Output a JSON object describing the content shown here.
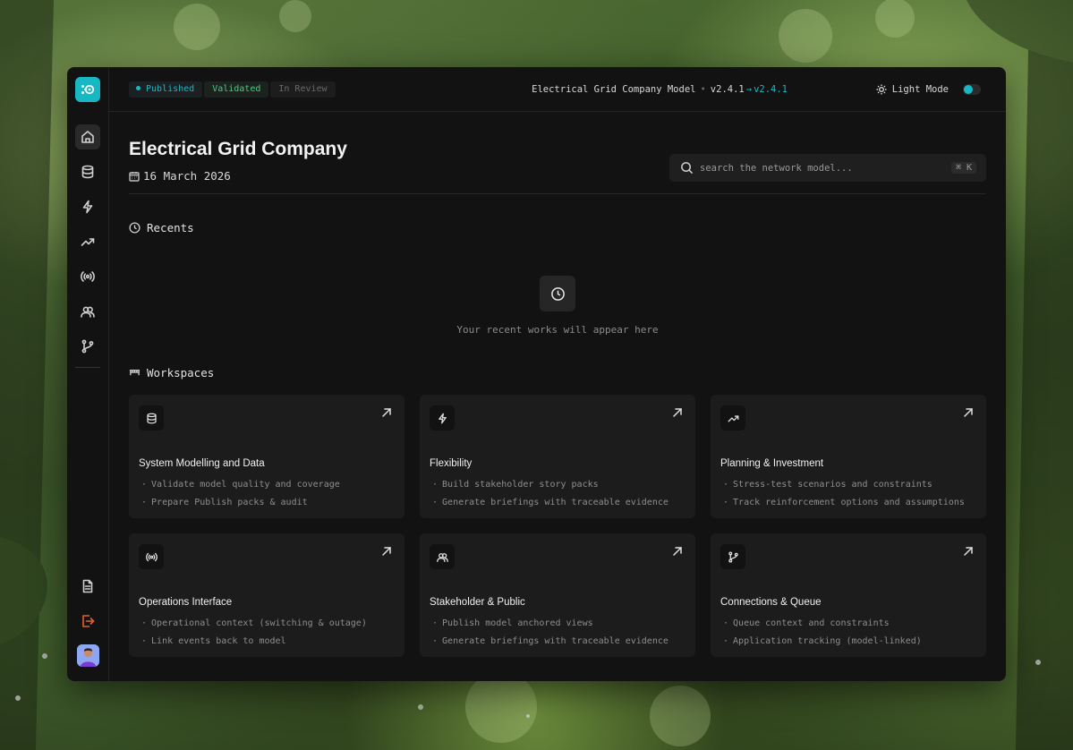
{
  "status_pills": [
    "Published",
    "Validated",
    "In Review"
  ],
  "model": {
    "name": "Electrical Grid Company Model",
    "version_from": "v2.4.1",
    "version_to": "v2.4.1"
  },
  "mode_label": "Light Mode",
  "page": {
    "title": "Electrical Grid Company",
    "date": "16 March 2026"
  },
  "search": {
    "placeholder": "search the network model...",
    "shortcut": "⌘ K"
  },
  "recents": {
    "heading": "Recents",
    "empty_text": "Your recent works will appear here"
  },
  "workspaces": {
    "heading": "Workspaces",
    "cards": [
      {
        "title": "System Modelling and Data",
        "icon": "database-icon",
        "bullets": [
          "Validate model quality and coverage",
          "Prepare Publish packs & audit"
        ]
      },
      {
        "title": "Flexibility",
        "icon": "lightning-icon",
        "bullets": [
          "Build stakeholder story packs",
          "Generate briefings with traceable evidence"
        ]
      },
      {
        "title": "Planning & Investment",
        "icon": "trending-up-icon",
        "bullets": [
          "Stress-test scenarios and constraints",
          "Track reinforcement options and assumptions"
        ]
      },
      {
        "title": "Operations Interface",
        "icon": "broadcast-icon",
        "bullets": [
          "Operational context (switching & outage)",
          "Link events back to model"
        ]
      },
      {
        "title": "Stakeholder & Public",
        "icon": "users-icon",
        "bullets": [
          "Publish model anchored views",
          "Generate briefings with traceable evidence"
        ]
      },
      {
        "title": "Connections & Queue",
        "icon": "git-branch-icon",
        "bullets": [
          "Queue context and constraints",
          "Application tracking (model-linked)"
        ]
      }
    ]
  },
  "sidebar": {
    "items": [
      "home-icon",
      "database-icon",
      "lightning-icon",
      "trending-up-icon",
      "broadcast-icon",
      "users-icon",
      "git-branch-icon"
    ],
    "bottom": [
      "document-icon",
      "logout-icon"
    ]
  },
  "colors": {
    "accent": "#18b7c4",
    "validated": "#4ec97f",
    "logout": "#e0622f"
  }
}
